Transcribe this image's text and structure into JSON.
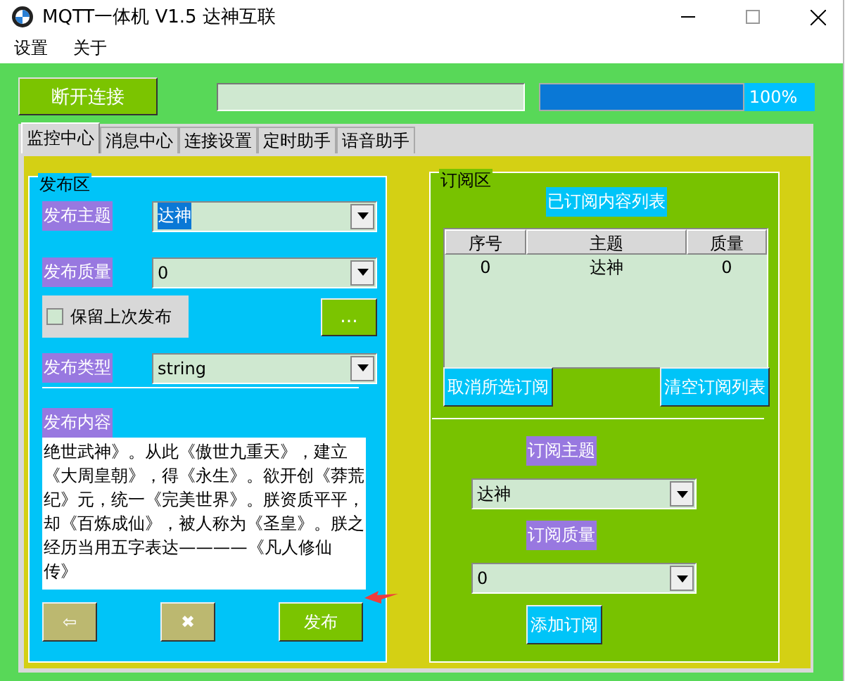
{
  "window": {
    "title": "MQTT一体机  V1.5 达神互联"
  },
  "menu": [
    {
      "label": "设置"
    },
    {
      "label": "关于"
    }
  ],
  "toolbar": {
    "connect_button": "断开连接",
    "progress": {
      "level": 1,
      "label": "100%"
    }
  },
  "tabs": [
    {
      "label": "监控中心",
      "selected": true
    },
    {
      "label": "消息中心",
      "selected": false
    },
    {
      "label": "连接设置",
      "selected": false
    },
    {
      "label": "定时助手",
      "selected": false
    },
    {
      "label": "语音助手",
      "selected": false
    }
  ],
  "publish": {
    "title": "发布区",
    "topic": {
      "label": "发布主题",
      "value": "达神",
      "highlighted": true
    },
    "qos": {
      "label": "发布质量",
      "value": "0"
    },
    "retain": {
      "label": "保留上次发布",
      "checked": false
    },
    "more_button": "...",
    "type": {
      "label": "发布类型",
      "value": "string"
    },
    "content": {
      "label": "发布内容",
      "value": "绝世武神》。从此《傲世九重天》，建立《大周皇朝》，得《永生》。欲开创《莽荒纪》元，统一《完美世界》。朕资质平平，却《百炼成仙》，被人称为《圣皇》。朕之经历当用五字表达————《凡人修仙传》"
    },
    "buttons": [
      {
        "label": "⇦",
        "kind": "back"
      },
      {
        "label": "✖",
        "kind": "clear"
      },
      {
        "label": "发布",
        "kind": "publish"
      }
    ]
  },
  "subscribe": {
    "title": "订阅区",
    "list_title": "已订阅内容列表",
    "table": {
      "columns": [
        "序号",
        "主题",
        "质量"
      ],
      "rows": [
        [
          "0",
          "达神",
          "0"
        ]
      ]
    },
    "buttons": [
      "取消所选订阅",
      "清空订阅列表"
    ],
    "topic": {
      "label": "订阅主题",
      "value": "达神"
    },
    "qos": {
      "label": "订阅质量",
      "value": "0"
    },
    "add_button": "添加订阅"
  }
}
